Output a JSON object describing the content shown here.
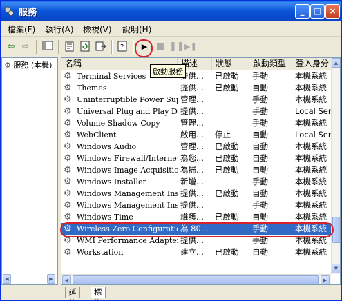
{
  "window": {
    "title": "服務"
  },
  "menu": [
    {
      "label": "檔案(F)"
    },
    {
      "label": "執行(A)"
    },
    {
      "label": "檢視(V)"
    },
    {
      "label": "說明(H)"
    }
  ],
  "toolbar": {
    "tooltip": "啟動服務"
  },
  "tree": {
    "root_label": "服務 (本機)"
  },
  "columns": [
    "名稱",
    "描述",
    "狀態",
    "啟動類型",
    "登入身分"
  ],
  "services": [
    {
      "name": "Terminal Services",
      "desc": "提供...",
      "status": "已啟動",
      "startup": "手動",
      "logon": "本機系統"
    },
    {
      "name": "Themes",
      "desc": "提供...",
      "status": "已啟動",
      "startup": "自動",
      "logon": "本機系統"
    },
    {
      "name": "Uninterruptible Power Supply",
      "desc": "管理...",
      "status": "",
      "startup": "手動",
      "logon": "本機系統"
    },
    {
      "name": "Universal Plug and Play Dev...",
      "desc": "提供...",
      "status": "",
      "startup": "手動",
      "logon": "Local Serv"
    },
    {
      "name": "Volume Shadow Copy",
      "desc": "管理...",
      "status": "",
      "startup": "手動",
      "logon": "本機系統"
    },
    {
      "name": "WebClient",
      "desc": "啟用...",
      "status": "停止",
      "startup": "自動",
      "logon": "Local Serv"
    },
    {
      "name": "Windows Audio",
      "desc": "管理...",
      "status": "已啟動",
      "startup": "自動",
      "logon": "本機系統"
    },
    {
      "name": "Windows Firewall/Internet ...",
      "desc": "為您...",
      "status": "已啟動",
      "startup": "自動",
      "logon": "本機系統"
    },
    {
      "name": "Windows Image Acquisition...",
      "desc": "為掃...",
      "status": "已啟動",
      "startup": "自動",
      "logon": "本機系統"
    },
    {
      "name": "Windows Installer",
      "desc": "新增...",
      "status": "",
      "startup": "手動",
      "logon": "本機系統"
    },
    {
      "name": "Windows Management Instr...",
      "desc": "提供...",
      "status": "已啟動",
      "startup": "自動",
      "logon": "本機系統"
    },
    {
      "name": "Windows Management Instr...",
      "desc": "提供...",
      "status": "",
      "startup": "手動",
      "logon": "本機系統"
    },
    {
      "name": "Windows Time",
      "desc": "維護...",
      "status": "已啟動",
      "startup": "自動",
      "logon": "本機系統"
    },
    {
      "name": "Wireless Zero Configuration",
      "desc": "為 80...",
      "status": "",
      "startup": "手動",
      "logon": "本機系統",
      "selected": true
    },
    {
      "name": "WMI Performance Adapter",
      "desc": "提供...",
      "status": "",
      "startup": "手動",
      "logon": "本機系統"
    },
    {
      "name": "Workstation",
      "desc": "建立...",
      "status": "已啟動",
      "startup": "自動",
      "logon": "本機系統"
    }
  ],
  "tabs": [
    {
      "label": "延伸"
    },
    {
      "label": "標準"
    }
  ],
  "colors": {
    "selection": "#316AC5",
    "highlight_ring": "#D8222A",
    "titlebar": "#0A55D8"
  }
}
